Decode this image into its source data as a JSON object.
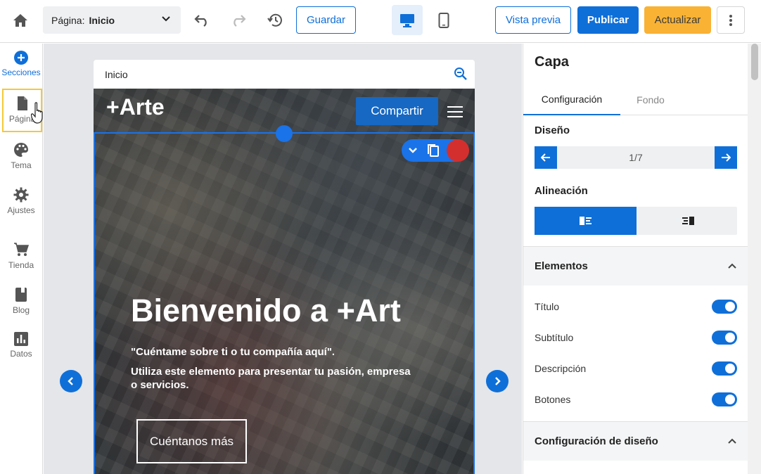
{
  "topbar": {
    "page_label": "Página:",
    "page_value": "Inicio",
    "save": "Guardar",
    "preview": "Vista previa",
    "publish": "Publicar",
    "update": "Actualizar"
  },
  "sidebar": {
    "items": [
      {
        "label": "Secciones"
      },
      {
        "label": "Página"
      },
      {
        "label": "Tema"
      },
      {
        "label": "Ajustes"
      },
      {
        "label": "Tienda"
      },
      {
        "label": "Blog"
      },
      {
        "label": "Datos"
      }
    ]
  },
  "canvas": {
    "page_name": "Inicio",
    "brand": "+Arte",
    "share": "Compartir",
    "title": "Bienvenido a +Art",
    "subtitle": "\"Cuéntame sobre ti o tu compañía aquí\".",
    "description": "Utiliza este elemento para presentar tu pasión, empresa o servicios.",
    "cta": "Cuéntanos más"
  },
  "panel": {
    "title": "Capa",
    "tabs": [
      "Configuración",
      "Fondo"
    ],
    "design_label": "Diseño",
    "design_value": "1/7",
    "alignment_label": "Alineación",
    "elements_label": "Elementos",
    "toggles": [
      {
        "label": "Título",
        "on": true
      },
      {
        "label": "Subtítulo",
        "on": true
      },
      {
        "label": "Descripción",
        "on": true
      },
      {
        "label": "Botones",
        "on": true
      }
    ],
    "layout_settings_label": "Configuración de diseño"
  },
  "colors": {
    "accent": "#0f6fd8",
    "warning": "#f9b234",
    "delete": "#d32f2f",
    "highlight": "#f4c938"
  }
}
